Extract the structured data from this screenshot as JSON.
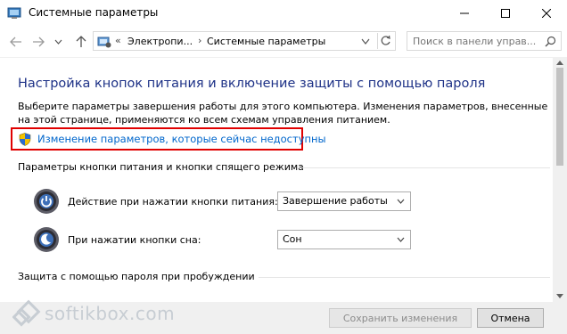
{
  "window": {
    "title": "Системные параметры",
    "controls": {
      "minimize": "minimize",
      "maximize": "maximize",
      "close": "close"
    }
  },
  "address": {
    "overflow": "«",
    "crumbs": [
      "Электропи...",
      "Системные параметры"
    ],
    "separator": "›",
    "search_placeholder": "Поиск в панели управ..."
  },
  "main": {
    "heading": "Настройка кнопок питания и включение защиты с помощью пароля",
    "description": "Выберите параметры завершения работы для этого компьютера. Изменения параметров, внесенные на этой странице, применяются ко всем схемам управления питанием.",
    "change_link": "Изменение параметров, которые сейчас недоступны",
    "section_buttons": "Параметры кнопки питания и кнопки спящего режима",
    "power_label": "Действие при нажатии кнопки питания:",
    "power_value": "Завершение работы",
    "sleep_label": "При нажатии кнопки сна:",
    "sleep_value": "Сон",
    "section_password": "Защита с помощью пароля при пробуждении"
  },
  "footer": {
    "save": "Сохранить изменения",
    "cancel": "Отмена"
  },
  "watermark": {
    "text": "softikbox.com"
  },
  "colors": {
    "heading": "#1e3287",
    "link": "#0066cc",
    "highlight": "#e00000"
  }
}
